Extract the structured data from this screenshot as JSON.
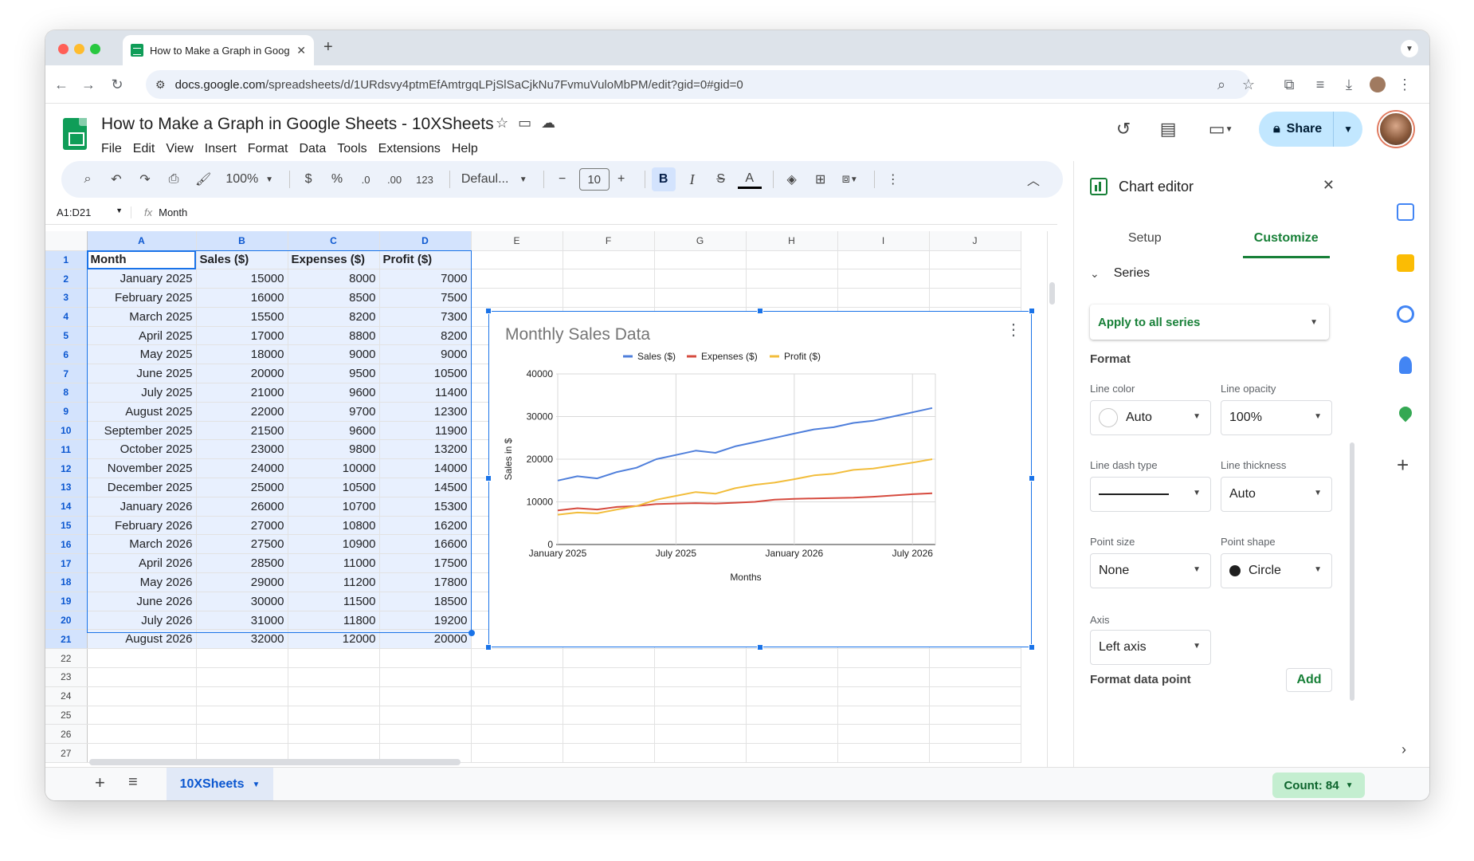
{
  "browser": {
    "tab_title": "How to Make a Graph in Goog",
    "url_host": "docs.google.com",
    "url_path": "/spreadsheets/d/1URdsvy4ptmEfAmtrgqLPjSlSaCjkNu7FvmuVuloMbPM/edit?gid=0#gid=0"
  },
  "doc": {
    "title": "How to Make a Graph in Google Sheets - 10XSheets",
    "menus": [
      "File",
      "Edit",
      "View",
      "Insert",
      "Format",
      "Data",
      "Tools",
      "Extensions",
      "Help"
    ],
    "share_label": "Share"
  },
  "toolbar": {
    "zoom": "100%",
    "currency": "$",
    "percent": "%",
    "dec_less": ".0",
    "dec_more": ".00",
    "number_fmt": "123",
    "font": "Defaul...",
    "font_size": "10",
    "bold": "B",
    "italic": "I"
  },
  "formula_bar": {
    "name_box": "A1:D21",
    "fx": "fx",
    "value": "Month"
  },
  "sheet": {
    "columns": [
      "A",
      "B",
      "C",
      "D",
      "E",
      "F",
      "G",
      "H",
      "I",
      "J"
    ],
    "rows": [
      [
        "Month",
        "Sales ($)",
        "Expenses ($)",
        "Profit ($)"
      ],
      [
        "January 2025",
        "15000",
        "8000",
        "7000"
      ],
      [
        "February 2025",
        "16000",
        "8500",
        "7500"
      ],
      [
        "March 2025",
        "15500",
        "8200",
        "7300"
      ],
      [
        "April 2025",
        "17000",
        "8800",
        "8200"
      ],
      [
        "May 2025",
        "18000",
        "9000",
        "9000"
      ],
      [
        "June 2025",
        "20000",
        "9500",
        "10500"
      ],
      [
        "July 2025",
        "21000",
        "9600",
        "11400"
      ],
      [
        "August 2025",
        "22000",
        "9700",
        "12300"
      ],
      [
        "September 2025",
        "21500",
        "9600",
        "11900"
      ],
      [
        "October 2025",
        "23000",
        "9800",
        "13200"
      ],
      [
        "November 2025",
        "24000",
        "10000",
        "14000"
      ],
      [
        "December 2025",
        "25000",
        "10500",
        "14500"
      ],
      [
        "January 2026",
        "26000",
        "10700",
        "15300"
      ],
      [
        "February 2026",
        "27000",
        "10800",
        "16200"
      ],
      [
        "March 2026",
        "27500",
        "10900",
        "16600"
      ],
      [
        "April 2026",
        "28500",
        "11000",
        "17500"
      ],
      [
        "May 2026",
        "29000",
        "11200",
        "17800"
      ],
      [
        "June 2026",
        "30000",
        "11500",
        "18500"
      ],
      [
        "July 2026",
        "31000",
        "11800",
        "19200"
      ],
      [
        "August 2026",
        "32000",
        "12000",
        "20000"
      ]
    ],
    "row_numbers": [
      "1",
      "2",
      "3",
      "4",
      "5",
      "6",
      "7",
      "8",
      "9",
      "10",
      "11",
      "12",
      "13",
      "14",
      "15",
      "16",
      "17",
      "18",
      "19",
      "20",
      "21",
      "22",
      "23",
      "24",
      "25",
      "26",
      "27"
    ],
    "tab_name": "10XSheets",
    "count_label": "Count: 84"
  },
  "chart_data": {
    "type": "line",
    "title": "Monthly Sales Data",
    "xlabel": "Months",
    "ylabel": "Sales in $",
    "ylim": [
      0,
      40000
    ],
    "yticks": [
      "0",
      "10000",
      "20000",
      "30000",
      "40000"
    ],
    "xtick_labels": [
      "January 2025",
      "July 2025",
      "January 2026",
      "July 2026"
    ],
    "xtick_index": [
      0,
      6,
      12,
      18
    ],
    "legend": "top",
    "grid": true,
    "categories": [
      "January 2025",
      "February 2025",
      "March 2025",
      "April 2025",
      "May 2025",
      "June 2025",
      "July 2025",
      "August 2025",
      "September 2025",
      "October 2025",
      "November 2025",
      "December 2025",
      "January 2026",
      "February 2026",
      "March 2026",
      "April 2026",
      "May 2026",
      "June 2026",
      "July 2026",
      "August 2026"
    ],
    "series": [
      {
        "name": "Sales ($)",
        "color": "#4f7fdb",
        "values": [
          15000,
          16000,
          15500,
          17000,
          18000,
          20000,
          21000,
          22000,
          21500,
          23000,
          24000,
          25000,
          26000,
          27000,
          27500,
          28500,
          29000,
          30000,
          31000,
          32000
        ]
      },
      {
        "name": "Expenses ($)",
        "color": "#d64b3f",
        "values": [
          8000,
          8500,
          8200,
          8800,
          9000,
          9500,
          9600,
          9700,
          9600,
          9800,
          10000,
          10500,
          10700,
          10800,
          10900,
          11000,
          11200,
          11500,
          11800,
          12000
        ]
      },
      {
        "name": "Profit ($)",
        "color": "#f2bd3b",
        "values": [
          7000,
          7500,
          7300,
          8200,
          9000,
          10500,
          11400,
          12300,
          11900,
          13200,
          14000,
          14500,
          15300,
          16200,
          16600,
          17500,
          17800,
          18500,
          19200,
          20000
        ]
      }
    ]
  },
  "editor": {
    "title": "Chart editor",
    "tabs": [
      "Setup",
      "Customize"
    ],
    "section": "Series",
    "apply_all": "Apply to all series",
    "format_heading": "Format",
    "line_color_label": "Line color",
    "line_color_value": "Auto",
    "line_opacity_label": "Line opacity",
    "line_opacity_value": "100%",
    "line_dash_label": "Line dash type",
    "line_thickness_label": "Line thickness",
    "line_thickness_value": "Auto",
    "point_size_label": "Point size",
    "point_size_value": "None",
    "point_shape_label": "Point shape",
    "point_shape_value": "Circle",
    "axis_label": "Axis",
    "axis_value": "Left axis",
    "format_point_label": "Format data point",
    "add_label": "Add"
  }
}
